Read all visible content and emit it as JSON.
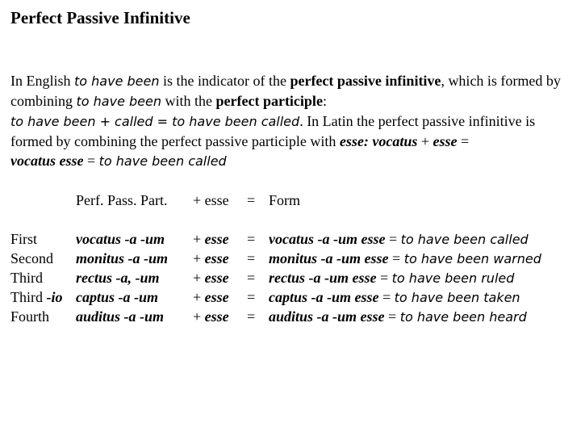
{
  "title": "Perfect Passive Infinitive",
  "paragraph": {
    "s1": "In English ",
    "s2": "to have been",
    "s3": " is the indicator of the ",
    "s4": "perfect passive infinitive",
    "s5": ", which is formed by combining ",
    "s6": "to have been",
    "s7": " with the ",
    "s8": "perfect participle",
    "s9": ":",
    "s10": "to have been + called = to have been called",
    "s11": ". In Latin the perfect passive infinitive is formed by combining the perfect passive participle with ",
    "s12": "esse: vocatus",
    "s13": " + ",
    "s14": "esse",
    "s15": " = ",
    "s16": "vocatus esse",
    "s17": " = ",
    "s18": "to have been called"
  },
  "table": {
    "header": {
      "ppp": "Perf. Pass. Part.",
      "esse": "+ esse",
      "eq": "=",
      "form": "Form"
    },
    "rows": [
      {
        "label": "First",
        "label_suffix": "",
        "ppp": "vocatus -a -um",
        "plus": "+ ",
        "esse": "esse",
        "eq": "=",
        "form_latin": "vocatus -a -um esse",
        "form_eq": " = ",
        "form_english": "to have been called"
      },
      {
        "label": "Second",
        "label_suffix": "",
        "ppp": "monitus -a -um",
        "plus": "+ ",
        "esse": "esse",
        "eq": "=",
        "form_latin": "monitus -a -um esse",
        "form_eq": " = ",
        "form_english": "to have been warned"
      },
      {
        "label": "Third",
        "label_suffix": "",
        "ppp": "rectus -a, -um",
        "plus": "+ ",
        "esse": "esse",
        "eq": "=",
        "form_latin": "rectus -a -um esse",
        "form_eq": " = ",
        "form_english": "to have been ruled"
      },
      {
        "label": "Third ",
        "label_suffix": "-io",
        "ppp": "captus -a -um",
        "plus": "+ ",
        "esse": "esse",
        "eq": "=",
        "form_latin": "captus -a -um esse",
        "form_eq": " = ",
        "form_english": "to have been taken"
      },
      {
        "label": "Fourth",
        "label_suffix": "",
        "ppp": "auditus -a -um",
        "plus": "+ ",
        "esse": "esse",
        "eq": "=",
        "form_latin": "auditus -a -um esse",
        "form_eq": " = ",
        "form_english": "to have been heard"
      }
    ]
  }
}
